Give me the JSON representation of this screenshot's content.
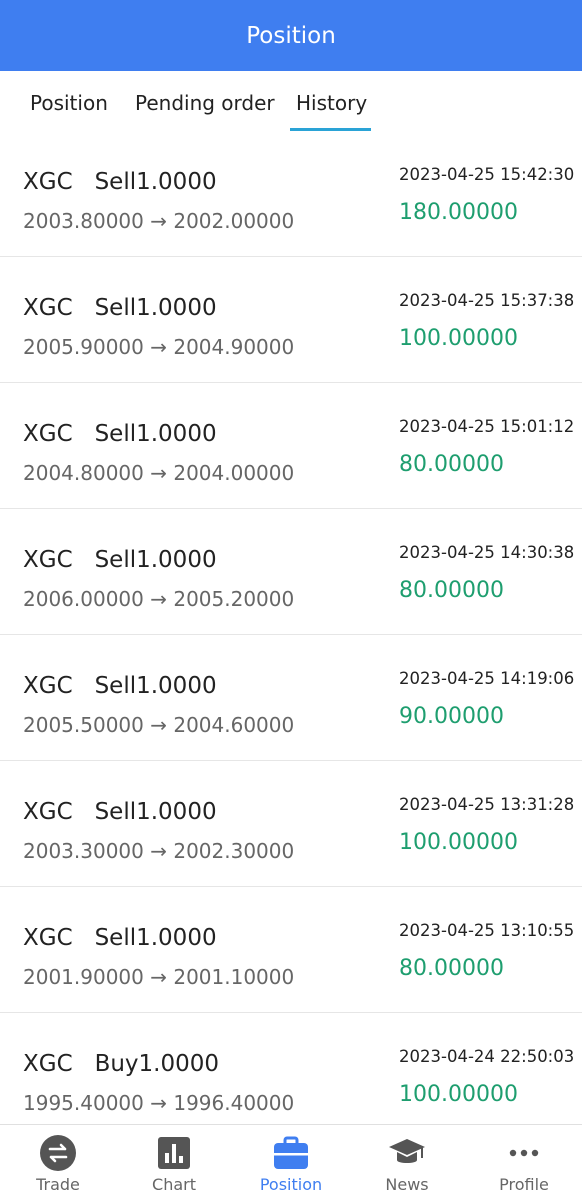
{
  "header": {
    "title": "Position"
  },
  "tabs": [
    {
      "label": "Position"
    },
    {
      "label": "Pending order"
    },
    {
      "label": "History"
    }
  ],
  "history": [
    {
      "title": "XGC   Sell1.0000",
      "prices": "2003.80000 → 2002.00000",
      "time": "2023-04-25 15:42:30",
      "profit": "180.00000"
    },
    {
      "title": "XGC   Sell1.0000",
      "prices": "2005.90000 → 2004.90000",
      "time": "2023-04-25 15:37:38",
      "profit": "100.00000"
    },
    {
      "title": "XGC   Sell1.0000",
      "prices": "2004.80000 → 2004.00000",
      "time": "2023-04-25 15:01:12",
      "profit": "80.00000"
    },
    {
      "title": "XGC   Sell1.0000",
      "prices": "2006.00000 → 2005.20000",
      "time": "2023-04-25 14:30:38",
      "profit": "80.00000"
    },
    {
      "title": "XGC   Sell1.0000",
      "prices": "2005.50000 → 2004.60000",
      "time": "2023-04-25 14:19:06",
      "profit": "90.00000"
    },
    {
      "title": "XGC   Sell1.0000",
      "prices": "2003.30000 → 2002.30000",
      "time": "2023-04-25 13:31:28",
      "profit": "100.00000"
    },
    {
      "title": "XGC   Sell1.0000",
      "prices": "2001.90000 → 2001.10000",
      "time": "2023-04-25 13:10:55",
      "profit": "80.00000"
    },
    {
      "title": "XGC   Buy1.0000",
      "prices": "1995.40000 → 1996.40000",
      "time": "2023-04-24 22:50:03",
      "profit": "100.00000"
    }
  ],
  "nav": [
    {
      "label": "Trade",
      "icon": "trade-icon"
    },
    {
      "label": "Chart",
      "icon": "chart-icon"
    },
    {
      "label": "Position",
      "icon": "briefcase-icon",
      "active": true
    },
    {
      "label": "News",
      "icon": "graduation-cap-icon"
    },
    {
      "label": "Profile",
      "icon": "more-dots-icon"
    }
  ],
  "colors": {
    "header_bg": "#3f7ef0",
    "profit_green": "#1e9e6f",
    "tab_underline": "#2aa3d6",
    "nav_active": "#3f7ef0",
    "nav_inactive": "#666666"
  }
}
